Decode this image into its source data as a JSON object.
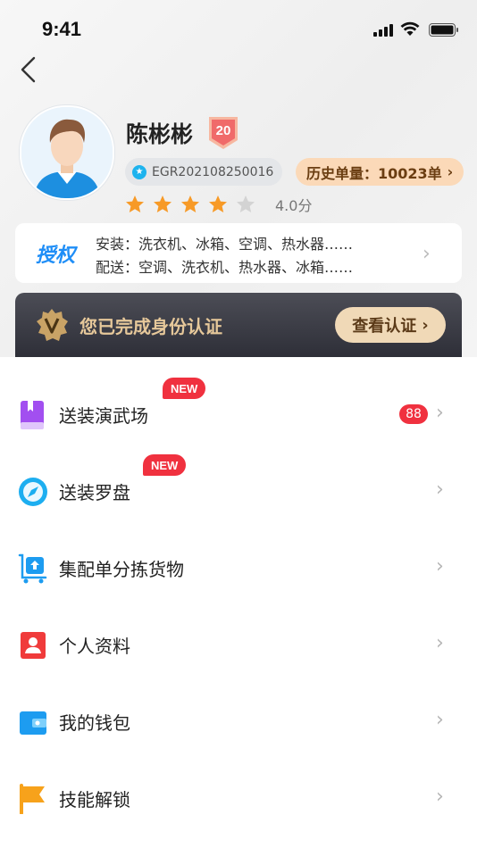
{
  "status_bar": {
    "time": "9:41"
  },
  "profile": {
    "name": "陈彬彬",
    "level": "20",
    "id": "EGR202108250016",
    "history_orders": "历史单量：10023单",
    "rating": 4.0,
    "rating_text": "4.0分"
  },
  "authorization": {
    "tag": "授权",
    "install": "安装：洗衣机、冰箱、空调、热水器……",
    "delivery": "配送：空调、洗衣机、热水器、冰箱……"
  },
  "verification": {
    "text": "您已完成身份认证",
    "button": "查看认证"
  },
  "menu": [
    {
      "label": "送装演武场",
      "badge": "NEW",
      "count": "88",
      "icon": "book-icon",
      "color": "#a24ff0"
    },
    {
      "label": "送装罗盘",
      "badge": "NEW",
      "icon": "compass-icon",
      "color": "#1daef0"
    },
    {
      "label": "集配单分拣货物",
      "icon": "cart-upload-icon",
      "color": "#1d9cf0"
    },
    {
      "label": "个人资料",
      "icon": "contact-card-icon",
      "color": "#f03b3b"
    },
    {
      "label": "我的钱包",
      "icon": "wallet-icon",
      "color": "#1d9cf0"
    },
    {
      "label": "技能解锁",
      "icon": "flag-icon",
      "color": "#f7a21b"
    }
  ],
  "colors": {
    "accent_blue": "#1f8ef7",
    "badge_red": "#f0313f",
    "gold": "#e6c89a"
  }
}
